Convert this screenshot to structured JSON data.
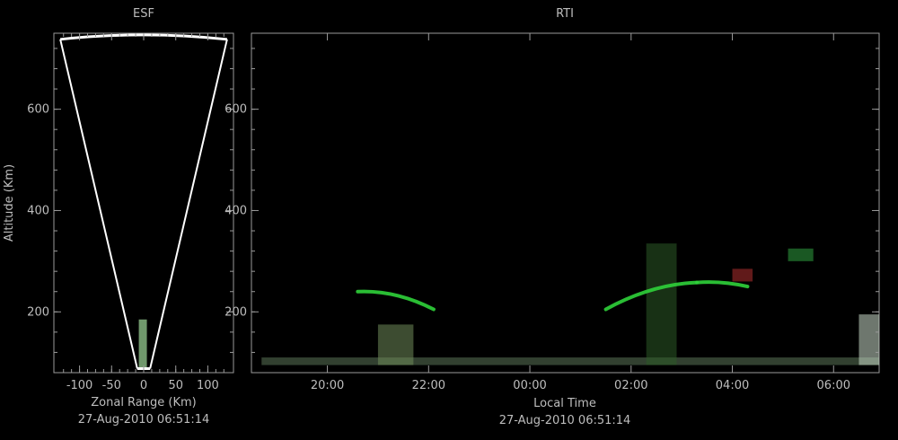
{
  "chart_data": [
    {
      "type": "heatmap",
      "title": "ESF",
      "xlabel": "Zonal Range (Km)",
      "ylabel": "Altitude (Km)",
      "timestamp": "27-Aug-2010 06:51:14",
      "xlim": [
        -140,
        140
      ],
      "ylim": [
        80,
        750
      ],
      "xticks": [
        -100,
        -50,
        0,
        50,
        100
      ],
      "xtick_labels": [
        "-100",
        "-50",
        "0",
        "50",
        "100"
      ],
      "yticks": [
        200,
        400,
        600
      ],
      "ytick_labels": [
        "200",
        "400",
        "600"
      ],
      "fan_beam": {
        "half_angle_km_at_top": 130,
        "top_altitude": 745,
        "bottom_altitude": 88
      },
      "echo_columns": [
        {
          "x": -2,
          "alt_from": 90,
          "alt_to": 185,
          "color": "#9fd89a"
        }
      ],
      "grid": false
    },
    {
      "type": "heatmap",
      "title": "RTI",
      "xlabel": "Local Time",
      "ylabel": "",
      "timestamp": "27-Aug-2010 06:51:14",
      "xlim": [
        18.5,
        30.9
      ],
      "ylim": [
        80,
        750
      ],
      "xticks": [
        20,
        22,
        24,
        26,
        28,
        30
      ],
      "xtick_labels": [
        "20:00",
        "22:00",
        "00:00",
        "02:00",
        "04:00",
        "06:00"
      ],
      "yticks": [
        200,
        400,
        600
      ],
      "ytick_labels": [
        "200",
        "400",
        "600"
      ],
      "grid": false,
      "echo_bands": [
        {
          "t_from": 20.6,
          "t_to": 22.1,
          "alt_start": 240,
          "alt_end": 205,
          "color": "#2fd13a"
        },
        {
          "t_from": 25.5,
          "t_to": 27.3,
          "alt_start": 205,
          "alt_end": 258,
          "color": "#2fd13a"
        },
        {
          "t_from": 27.3,
          "t_to": 28.3,
          "alt_start": 258,
          "alt_end": 250,
          "color": "#2fd13a"
        }
      ],
      "echo_columns": [
        {
          "t_from": 21.0,
          "t_to": 21.7,
          "alt_from": 95,
          "alt_to": 175,
          "color": "#6f8a5a"
        },
        {
          "t_from": 26.3,
          "t_to": 26.9,
          "alt_from": 95,
          "alt_to": 335,
          "color": "#2c5a26"
        },
        {
          "t_from": 28.0,
          "t_to": 28.4,
          "alt_from": 260,
          "alt_to": 285,
          "color": "#b03030"
        },
        {
          "t_from": 29.1,
          "t_to": 29.6,
          "alt_from": 300,
          "alt_to": 325,
          "color": "#2fa040"
        },
        {
          "t_from": 30.5,
          "t_to": 30.9,
          "alt_from": 95,
          "alt_to": 195,
          "color": "#c8d8c8"
        }
      ],
      "low_altitude_layer": {
        "alt_from": 95,
        "alt_to": 110,
        "color": "#8fb88a"
      }
    }
  ]
}
